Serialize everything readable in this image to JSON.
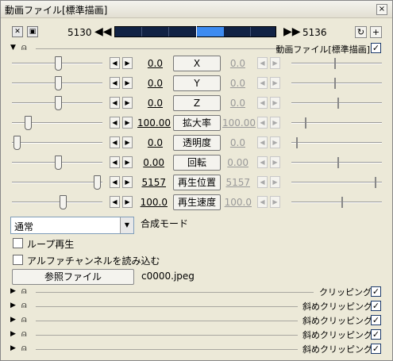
{
  "window": {
    "title": "動画ファイル[標準描画]",
    "close_label": "×"
  },
  "timeline": {
    "start_frame": "5130",
    "end_frame": "5136",
    "prev_label": "◀◀",
    "next_label": "▶▶"
  },
  "header": {
    "label": "動画ファイル[標準描画]",
    "checked": "✓"
  },
  "params": [
    {
      "name": "X",
      "left_value": "0.0",
      "right_value": "0.0",
      "right_enabled": false
    },
    {
      "name": "Y",
      "left_value": "0.0",
      "right_value": "0.0",
      "right_enabled": false
    },
    {
      "name": "Z",
      "left_value": "0.0",
      "right_value": "0.0",
      "right_enabled": false
    },
    {
      "name": "拡大率",
      "left_value": "100.00",
      "right_value": "100.00",
      "right_enabled": false
    },
    {
      "name": "透明度",
      "left_value": "0.0",
      "right_value": "0.0",
      "right_enabled": false
    },
    {
      "name": "回転",
      "left_value": "0.00",
      "right_value": "0.00",
      "right_enabled": false
    },
    {
      "name": "再生位置",
      "left_value": "5157",
      "right_value": "5157",
      "right_enabled": false
    },
    {
      "name": "再生速度",
      "left_value": "100.0",
      "right_value": "100.0",
      "right_enabled": false
    }
  ],
  "blend": {
    "value": "通常",
    "label": "合成モード"
  },
  "loop": {
    "label": "ループ再生",
    "checked": false
  },
  "alpha": {
    "label": "アルファチャンネルを読み込む",
    "checked": false
  },
  "file": {
    "button_label": "参照ファイル",
    "filename": "c0000.jpeg"
  },
  "filters": [
    {
      "label": "クリッピング",
      "checked": "✓"
    },
    {
      "label": "斜めクリッピング",
      "checked": "✓"
    },
    {
      "label": "斜めクリッピング",
      "checked": "✓"
    },
    {
      "label": "斜めクリッピング",
      "checked": "✓"
    },
    {
      "label": "斜めクリッピング",
      "checked": "✓"
    }
  ]
}
